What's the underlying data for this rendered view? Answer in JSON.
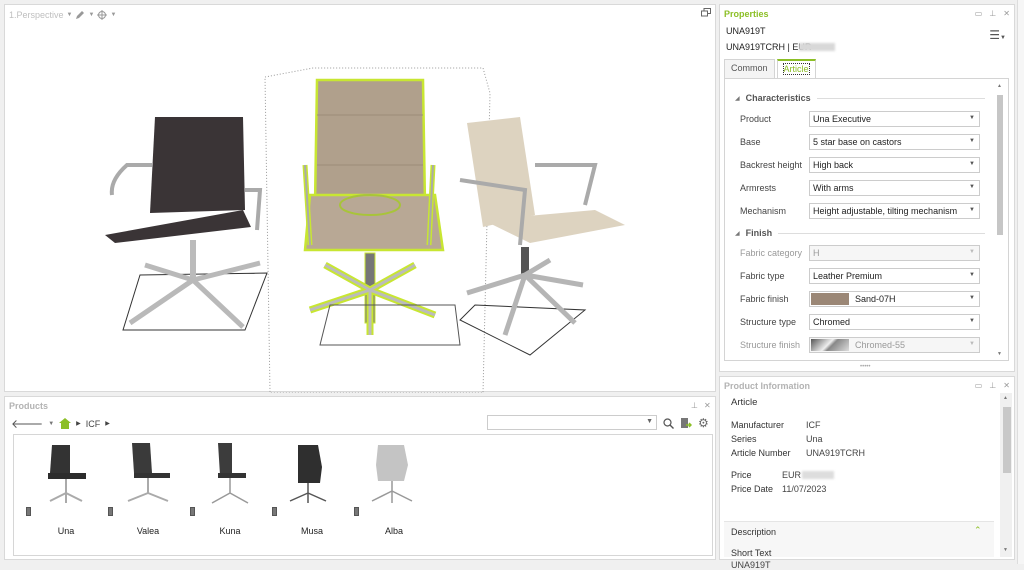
{
  "viewport": {
    "view_label": "1.Perspective",
    "tool_icons": [
      "pencil-icon",
      "crosshair-icon"
    ],
    "restore_icon": "window-restore-icon",
    "selected_chair_color": "#b0a08c",
    "highlight_color": "#c8e632"
  },
  "products": {
    "title": "Products",
    "breadcrumb": [
      "ICF"
    ],
    "search_value": "",
    "items": [
      {
        "label": "Una"
      },
      {
        "label": "Valea"
      },
      {
        "label": "Kuna"
      },
      {
        "label": "Musa"
      },
      {
        "label": "Alba"
      }
    ]
  },
  "properties": {
    "title": "Properties",
    "code": "UNA919T",
    "article_line": "UNA919TCRH | EUR",
    "tabs": [
      {
        "label": "Common"
      },
      {
        "label": "Article"
      }
    ],
    "active_tab": "Article",
    "sections": {
      "characteristics": "Characteristics",
      "finish": "Finish"
    },
    "rows": [
      {
        "label": "Product",
        "value": "Una Executive"
      },
      {
        "label": "Base",
        "value": "5 star base on castors"
      },
      {
        "label": "Backrest height",
        "value": "High back"
      },
      {
        "label": "Armrests",
        "value": "With arms"
      },
      {
        "label": "Mechanism",
        "value": "Height adjustable, tilting mechanism"
      },
      {
        "label": "Fabric category",
        "value": "H",
        "disabled": true
      },
      {
        "label": "Fabric type",
        "value": "Leather Premium"
      },
      {
        "label": "Fabric finish",
        "value": "Sand-07H",
        "swatch": "#9b8776"
      },
      {
        "label": "Structure type",
        "value": "Chromed"
      },
      {
        "label": "Structure finish",
        "value": "Chromed-55",
        "disabled": true
      }
    ],
    "accent_color": "#8cbf26"
  },
  "product_info": {
    "title": "Product Information",
    "heading": "Article",
    "fields": [
      {
        "label": "Manufacturer",
        "value": "ICF"
      },
      {
        "label": "Series",
        "value": "Una"
      },
      {
        "label": "Article Number",
        "value": "UNA919TCRH"
      }
    ],
    "price_label": "Price",
    "price_value": "EUR",
    "price_date_label": "Price Date",
    "price_date_value": "11/07/2023",
    "description_header": "Description",
    "short_text_label": "Short Text",
    "short_text_value": "UNA919T"
  }
}
